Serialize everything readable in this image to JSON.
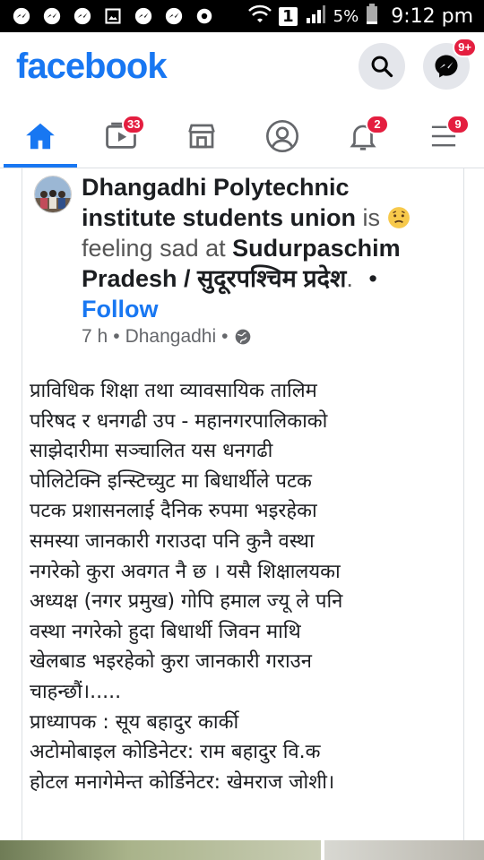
{
  "status_bar": {
    "notification_icons": [
      "chat-bubble-icon",
      "messenger-icon",
      "messenger-icon",
      "image-icon",
      "messenger-icon",
      "messenger-icon",
      "settings-icon"
    ],
    "sim_indicator": "1",
    "battery": "5%",
    "time": "9:12 pm"
  },
  "header": {
    "logo": "facebook",
    "messenger_badge": "9+"
  },
  "tabs": [
    {
      "name": "home",
      "icon": "home-icon",
      "badge": ""
    },
    {
      "name": "watch",
      "icon": "video-icon",
      "badge": "33"
    },
    {
      "name": "marketplace",
      "icon": "marketplace-icon",
      "badge": ""
    },
    {
      "name": "profile",
      "icon": "profile-icon",
      "badge": ""
    },
    {
      "name": "notifications",
      "icon": "bell-icon",
      "badge": "2"
    },
    {
      "name": "menu",
      "icon": "menu-icon",
      "badge": "9"
    }
  ],
  "post": {
    "author": "Dhangadhi Polytechnic institute students union",
    "is_text": "is",
    "feeling": "feeling sad at",
    "place": "Sudurpaschim Pradesh / सुदूरपश्चिम प्रदेश",
    "dot": ".",
    "bullet": "•",
    "follow": "Follow",
    "time": "7 h",
    "sep": "•",
    "location": "Dhangadhi",
    "sep2": "•",
    "body_lines": [
      "प्राविधिक शिक्षा तथा व्यावसायिक तालिम",
      "परिषद र धनगढी उप - महानगरपालिकाको",
      "साझेदारीमा सञ्चालित यस धनगढी",
      "पोलिटेक्नि इन्स्टिच्युट मा बिधार्थीले पटक",
      "पटक प्रशासनलाई दैनिक रुपमा भइरहेका",
      "समस्या जानकारी गराउदा पनि कुनै वस्था",
      "नगरेको कुरा अवगत नै छ । यसै शिक्षालयका",
      "अध्यक्ष (नगर प्रमुख) गोपि हमाल ज्यू ले पनि",
      "वस्था नगरेको हुदा बिधार्थी जिवन माथि",
      "खेलबाड भइरहेको कुरा जानकारी गराउन",
      "चाहन्छौं।.....",
      "प्राध्यापक : सूय बहादुर कार्की",
      "अटोमोबाइल कोडिनेटर: राम बहादुर वि.क",
      "होटल मनागेमेन्त कोर्डिनेटर: खेमराज जोशी।"
    ]
  },
  "colors": {
    "brand": "#1877f2",
    "badge": "#e41e3f",
    "text": "#1c1e21",
    "muted": "#65676b"
  }
}
